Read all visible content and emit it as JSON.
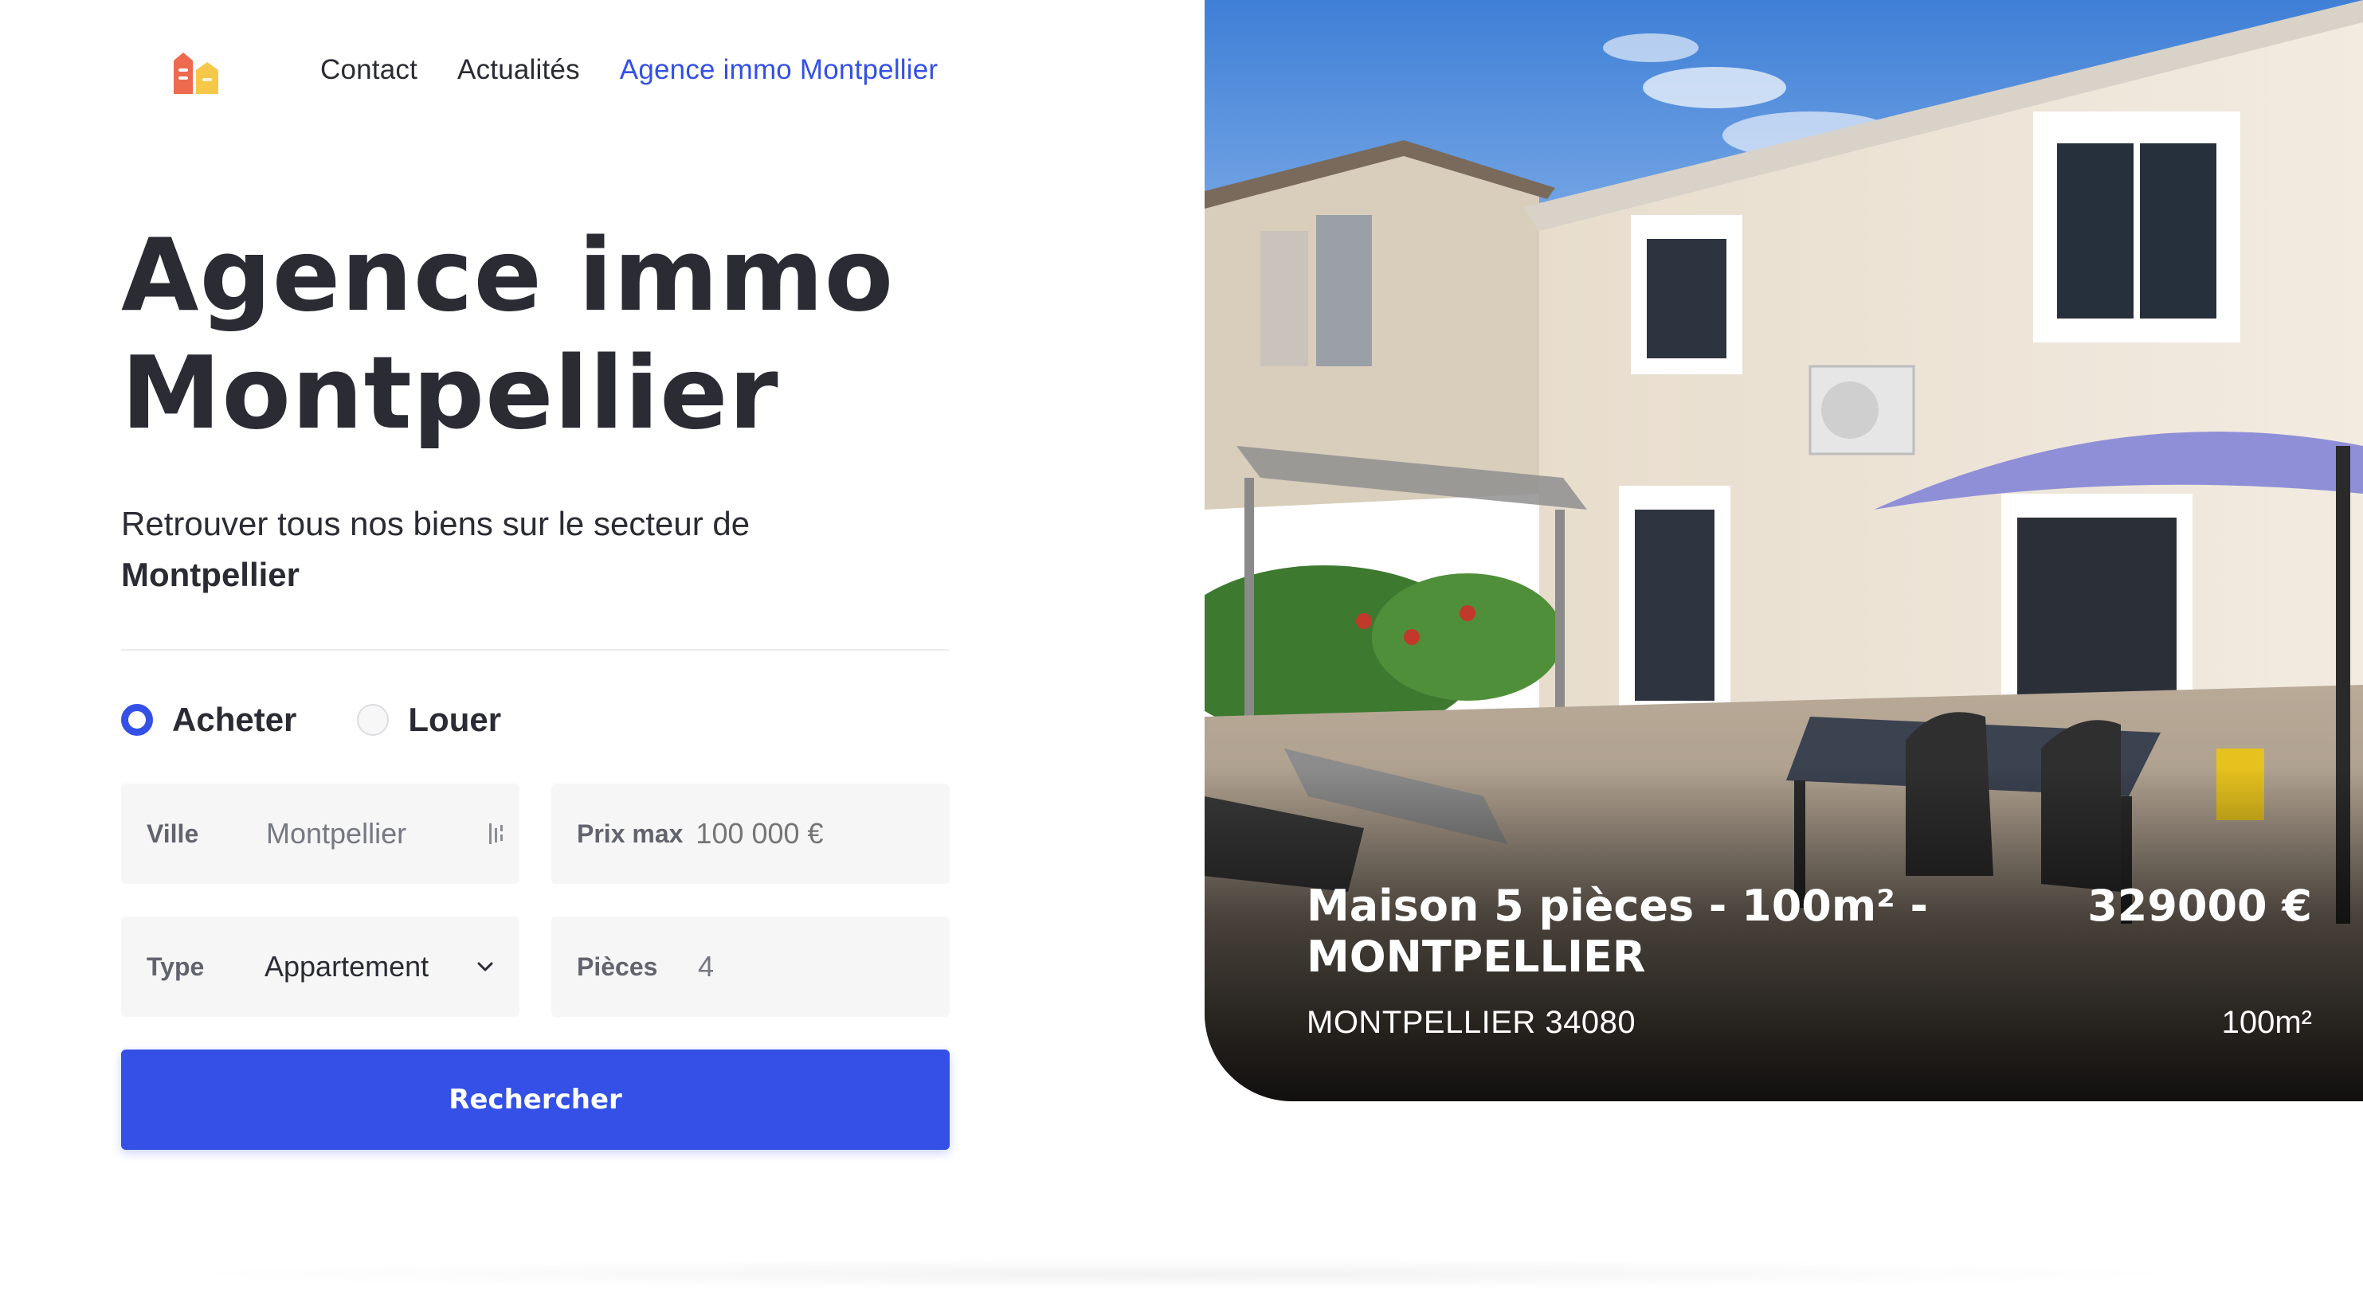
{
  "nav": {
    "items": [
      {
        "label": "Contact"
      },
      {
        "label": "Actualités"
      },
      {
        "label": "Agence immo Montpellier",
        "active": true
      }
    ]
  },
  "hero": {
    "title": "Agence immo Montpellier",
    "subtitle_prefix": "Retrouver tous nos biens sur le secteur de",
    "subtitle_city": "Montpellier"
  },
  "search": {
    "mode_options": [
      {
        "label": "Acheter",
        "selected": true
      },
      {
        "label": "Louer",
        "selected": false
      }
    ],
    "ville": {
      "label": "Ville",
      "value": "Montpellier"
    },
    "prix_max": {
      "label": "Prix max",
      "placeholder": "100 000 €"
    },
    "type": {
      "label": "Type",
      "value": "Appartement"
    },
    "pieces": {
      "label": "Pièces",
      "value": "4"
    },
    "submit_label": "Rechercher"
  },
  "property": {
    "title": "Maison 5 pièces - 100m² - MONTPELLIER",
    "price": "329000 €",
    "address": "MONTPELLIER 34080",
    "area": "100m²"
  },
  "colors": {
    "accent": "#3450e6",
    "text": "#2a2b33",
    "field_bg": "#f6f6f7",
    "logo_red": "#ee6a4f",
    "logo_yellow": "#f6c84a"
  },
  "icons": {
    "logo": "house-logo-icon",
    "ville_trailing": "list-icon",
    "type_trailing": "chevron-down-icon"
  }
}
